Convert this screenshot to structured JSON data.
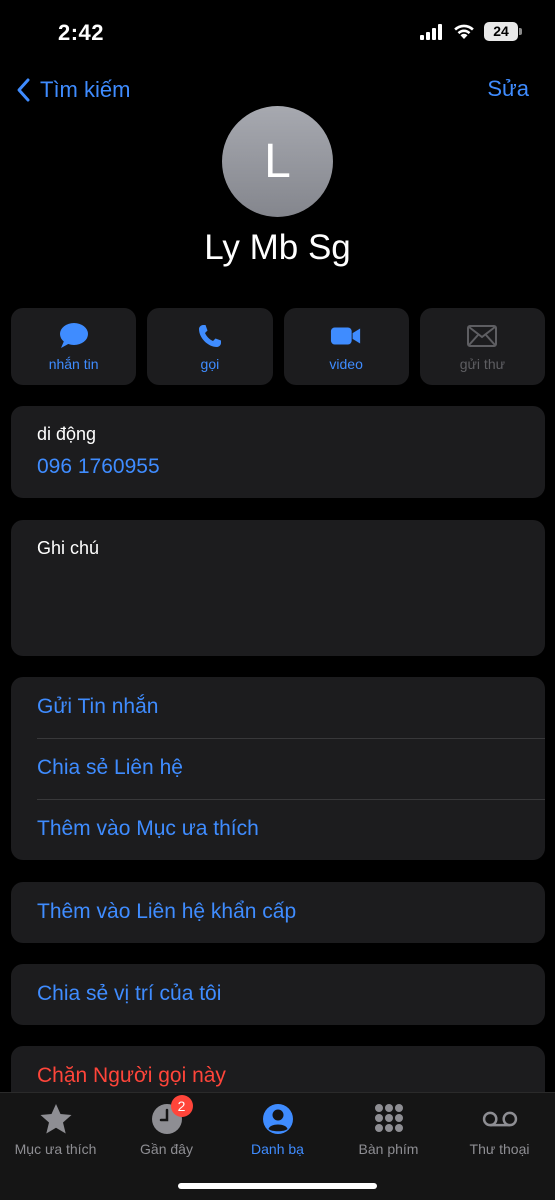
{
  "status_bar": {
    "time": "2:42",
    "battery": "24"
  },
  "nav": {
    "back_label": "Tìm kiếm",
    "edit_label": "Sửa"
  },
  "contact": {
    "initial": "L",
    "name": "Ly Mb Sg"
  },
  "actions": [
    {
      "label": "nhắn tin",
      "icon": "message-icon",
      "enabled": true
    },
    {
      "label": "gọi",
      "icon": "phone-icon",
      "enabled": true
    },
    {
      "label": "video",
      "icon": "video-icon",
      "enabled": true
    },
    {
      "label": "gửi thư",
      "icon": "mail-icon",
      "enabled": false
    }
  ],
  "phone": {
    "label": "di động",
    "number": "096 1760955"
  },
  "notes": {
    "label": "Ghi chú"
  },
  "options": {
    "send_message": "Gửi Tin nhắn",
    "share_contact": "Chia sẻ Liên hệ",
    "add_favorite": "Thêm vào Mục ưa thích",
    "add_emergency": "Thêm vào Liên hệ khẩn cấp",
    "share_location": "Chia sẻ vị trí của tôi",
    "block_caller": "Chặn Người gọi này"
  },
  "tabbar": {
    "items": [
      {
        "label": "Mục ưa thích",
        "icon": "star-icon"
      },
      {
        "label": "Gần đây",
        "icon": "clock-icon",
        "badge": "2"
      },
      {
        "label": "Danh bạ",
        "icon": "person-circle-icon",
        "active": true
      },
      {
        "label": "Bàn phím",
        "icon": "keypad-icon"
      },
      {
        "label": "Thư thoại",
        "icon": "voicemail-icon"
      }
    ]
  },
  "colors": {
    "accent": "#3f8cff",
    "destructive": "#ff453a",
    "card": "#1c1c1e",
    "background": "#000000"
  }
}
